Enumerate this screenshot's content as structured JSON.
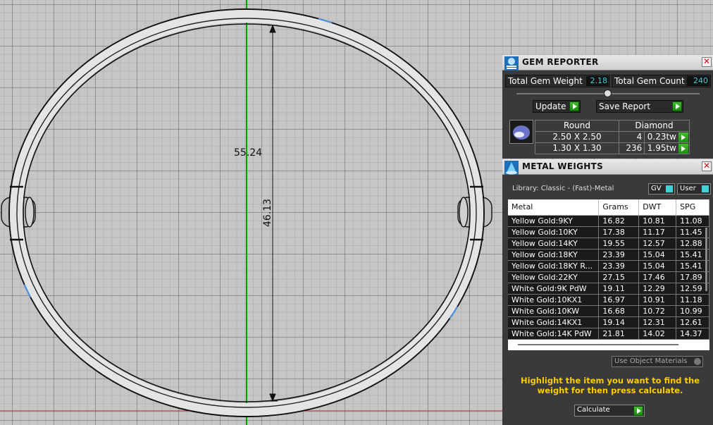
{
  "viewport": {
    "dim_horizontal": "55.24",
    "dim_vertical": "46.13"
  },
  "gem_reporter": {
    "title": "GEM REPORTER",
    "total_gem_weight_label": "Total Gem Weight",
    "total_gem_weight_value": "2.18",
    "total_gem_count_label": "Total Gem Count",
    "total_gem_count_value": "240",
    "update_label": "Update",
    "save_report_label": "Save Report",
    "shape_header": "Round",
    "material_header": "Diamond",
    "rows": [
      {
        "size": "2.50 X 2.50",
        "count": "4",
        "weight": "0.23tw"
      },
      {
        "size": "1.30 X 1.30",
        "count": "236",
        "weight": "1.95tw"
      }
    ]
  },
  "metal_weights": {
    "title": "METAL WEIGHTS",
    "library_label": "Library: Classic - (Fast)-Metal",
    "gv_label": "GV",
    "user_label": "User",
    "columns": [
      "Metal",
      "Grams",
      "DWT",
      "SPG"
    ],
    "rows": [
      [
        "Yellow Gold:9KY",
        "16.82",
        "10.81",
        "11.08"
      ],
      [
        "Yellow Gold:10KY",
        "17.38",
        "11.17",
        "11.45"
      ],
      [
        "Yellow Gold:14KY",
        "19.55",
        "12.57",
        "12.88"
      ],
      [
        "Yellow Gold:18KY",
        "23.39",
        "15.04",
        "15.41"
      ],
      [
        "Yellow Gold:18KY R...",
        "23.39",
        "15.04",
        "15.41"
      ],
      [
        "Yellow Gold:22KY",
        "27.15",
        "17.46",
        "17.89"
      ],
      [
        "White Gold:9K PdW",
        "19.11",
        "12.29",
        "12.59"
      ],
      [
        "White Gold:10KX1",
        "16.97",
        "10.91",
        "11.18"
      ],
      [
        "White Gold:10KW",
        "16.68",
        "10.72",
        "10.99"
      ],
      [
        "White Gold:14KX1",
        "19.14",
        "12.31",
        "12.61"
      ],
      [
        "White Gold:14K PdW",
        "21.81",
        "14.02",
        "14.37"
      ]
    ],
    "use_object_materials_label": "Use Object Materials",
    "instruction": "Highlight the item you want to find the weight for then press calculate.",
    "calculate_label": "Calculate"
  },
  "colors": {
    "instruction_text": "#ffcc00",
    "value_readout": "#3fd2d6",
    "axis_green": "#00a000",
    "axis_red": "#d01020",
    "go_button": "#2aa51e"
  }
}
